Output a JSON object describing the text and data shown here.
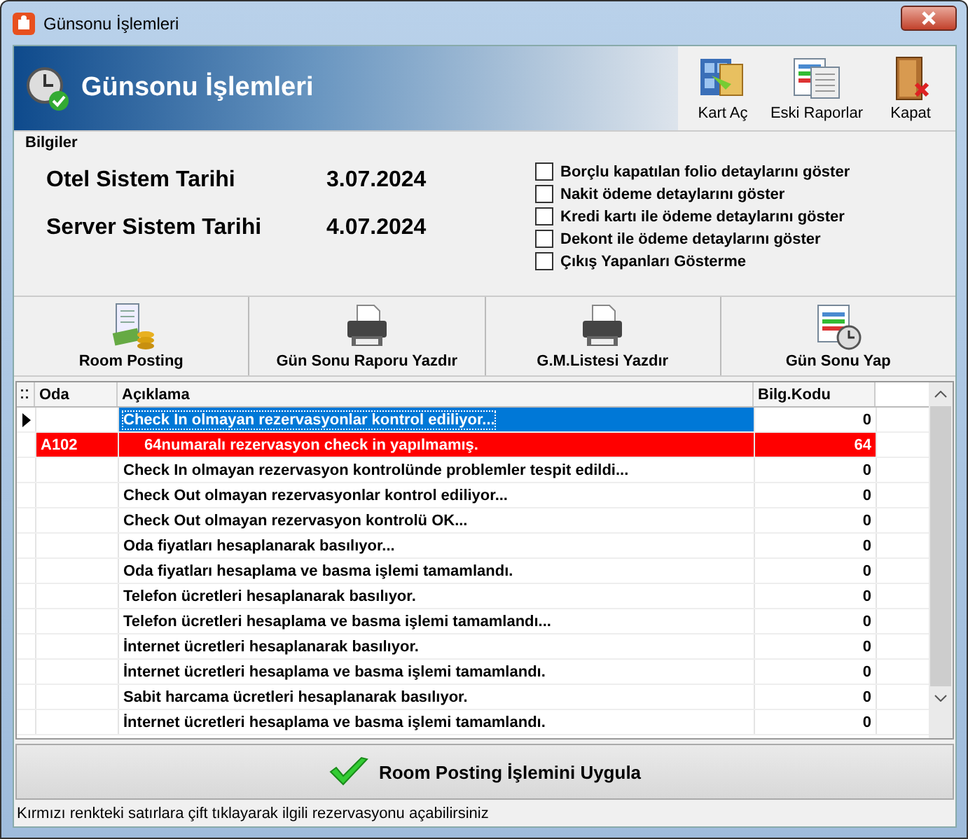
{
  "window": {
    "title": "Günsonu İşlemleri"
  },
  "header": {
    "title": "Günsonu İşlemleri",
    "buttons": [
      {
        "label": "Kart Aç"
      },
      {
        "label": "Eski Raporlar"
      },
      {
        "label": "Kapat"
      }
    ]
  },
  "info": {
    "title": "Bilgiler",
    "dates": [
      {
        "label": "Otel Sistem Tarihi",
        "value": "3.07.2024"
      },
      {
        "label": "Server Sistem Tarihi",
        "value": "4.07.2024"
      }
    ],
    "options": [
      {
        "label": "Borçlu kapatılan folio detaylarını göster",
        "checked": false
      },
      {
        "label": "Nakit ödeme detaylarını göster",
        "checked": false
      },
      {
        "label": "Kredi kartı ile ödeme detaylarını göster",
        "checked": false
      },
      {
        "label": "Dekont ile ödeme detaylarını göster",
        "checked": false
      },
      {
        "label": "Çıkış Yapanları Gösterme",
        "checked": false
      }
    ]
  },
  "toolbar": [
    {
      "label": "Room Posting"
    },
    {
      "label": "Gün Sonu Raporu Yazdır"
    },
    {
      "label": "G.M.Listesi Yazdır"
    },
    {
      "label": "Gün Sonu Yap"
    }
  ],
  "table": {
    "columns": [
      "Oda",
      "Açıklama",
      "Bilg.Kodu"
    ],
    "rows": [
      {
        "oda": "",
        "text": "Check In olmayan rezervasyonlar kontrol ediliyor...",
        "code": "0",
        "kind": "info",
        "selected": true
      },
      {
        "oda": "A102",
        "text": "64numaralı rezervasyon check in yapılmamış.",
        "code": "64",
        "kind": "error",
        "selected": false
      },
      {
        "oda": "",
        "text": "Check In olmayan rezervasyon kontrolünde problemler tespit edildi...",
        "code": "0",
        "kind": "info",
        "selected": false
      },
      {
        "oda": "",
        "text": "Check Out olmayan rezervasyonlar kontrol ediliyor...",
        "code": "0",
        "kind": "info",
        "selected": false
      },
      {
        "oda": "",
        "text": "Check Out olmayan rezervasyon kontrolü OK...",
        "code": "0",
        "kind": "info",
        "selected": false
      },
      {
        "oda": "",
        "text": "Oda fiyatları hesaplanarak basılıyor...",
        "code": "0",
        "kind": "info",
        "selected": false
      },
      {
        "oda": "",
        "text": "Oda fiyatları hesaplama ve basma işlemi tamamlandı.",
        "code": "0",
        "kind": "info",
        "selected": false
      },
      {
        "oda": "",
        "text": "Telefon ücretleri hesaplanarak basılıyor.",
        "code": "0",
        "kind": "info",
        "selected": false
      },
      {
        "oda": "",
        "text": "Telefon ücretleri hesaplama ve basma işlemi tamamlandı...",
        "code": "0",
        "kind": "info",
        "selected": false
      },
      {
        "oda": "",
        "text": "İnternet ücretleri hesaplanarak basılıyor.",
        "code": "0",
        "kind": "info",
        "selected": false
      },
      {
        "oda": "",
        "text": "İnternet ücretleri hesaplama ve basma işlemi tamamlandı.",
        "code": "0",
        "kind": "info",
        "selected": false
      },
      {
        "oda": "",
        "text": "Sabit harcama ücretleri hesaplanarak basılıyor.",
        "code": "0",
        "kind": "info",
        "selected": false
      },
      {
        "oda": "",
        "text": "İnternet ücretleri hesaplama ve basma işlemi tamamlandı.",
        "code": "0",
        "kind": "info",
        "selected": false
      }
    ]
  },
  "apply_button": {
    "label": "Room Posting İşlemini Uygula"
  },
  "status_bar": {
    "text": "Kırmızı renkteki satırlara çift tıklayarak ilgili rezervasyonu açabilirsiniz"
  }
}
